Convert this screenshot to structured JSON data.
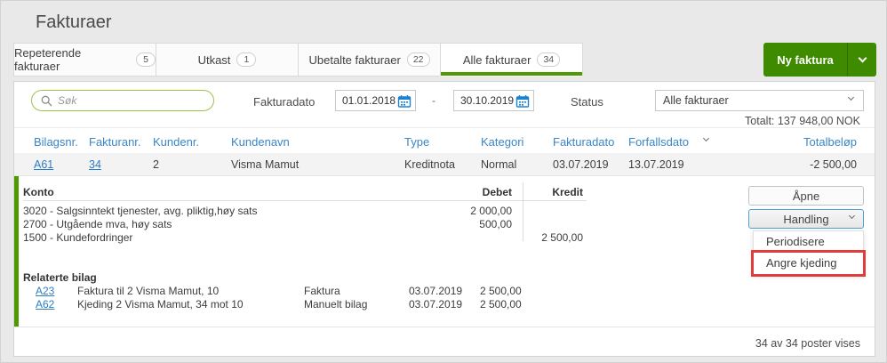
{
  "page": {
    "title": "Fakturaer"
  },
  "tabs": [
    {
      "label": "Repeterende fakturaer",
      "count": "5"
    },
    {
      "label": "Utkast",
      "count": "1"
    },
    {
      "label": "Ubetalte fakturaer",
      "count": "22"
    },
    {
      "label": "Alle fakturaer",
      "count": "34"
    }
  ],
  "new_invoice": {
    "label": "Ny faktura"
  },
  "filters": {
    "search_placeholder": "Søk",
    "invoice_date_label": "Fakturadato",
    "date_from": "01.01.2018",
    "date_separator": "-",
    "date_to": "30.10.2019",
    "status_label": "Status",
    "status_value": "Alle fakturaer",
    "total_label": "Totalt: 137 948,00 NOK"
  },
  "table": {
    "headers": {
      "bilagsnr": "Bilagsnr.",
      "fakturanr": "Fakturanr.",
      "kundenr": "Kundenr.",
      "kundenavn": "Kundenavn",
      "type": "Type",
      "kategori": "Kategori",
      "fakturadato": "Fakturadato",
      "forfallsdato": "Forfallsdato",
      "totalbelop": "Totalbeløp"
    },
    "row": {
      "bilagsnr": "A61",
      "fakturanr": "34",
      "kundenr": "2",
      "kundenavn": "Visma Mamut",
      "type": "Kreditnota",
      "kategori": "Normal",
      "fakturadato": "03.07.2019",
      "forfallsdato": "13.07.2019",
      "totalbelop": "-2 500,00"
    }
  },
  "detail": {
    "konto_header": "Konto",
    "debet_header": "Debet",
    "kredit_header": "Kredit",
    "accounts": [
      {
        "name": "3020 - Salgsinntekt tjenester, avg. pliktig,høy sats",
        "debet": "2 000,00",
        "kredit": ""
      },
      {
        "name": "2700 - Utgående mva, høy sats",
        "debet": "500,00",
        "kredit": ""
      },
      {
        "name": "1500 - Kundefordringer",
        "debet": "",
        "kredit": "2 500,00"
      }
    ],
    "open_button": "Åpne",
    "action_button": "Handling",
    "menu": [
      {
        "label": "Periodisere"
      },
      {
        "label": "Angre kjeding"
      }
    ],
    "related_header": "Relaterte bilag",
    "related": [
      {
        "link": "A23",
        "description": "Faktura til 2 Visma Mamut, 10",
        "type": "Faktura",
        "date": "03.07.2019",
        "amount": "2 500,00"
      },
      {
        "link": "A62",
        "description": "Kjeding 2 Visma Mamut, 34 mot 10",
        "type": "Manuelt bilag",
        "date": "03.07.2019",
        "amount": "2 500,00"
      }
    ]
  },
  "footer": {
    "count_text": "34 av 34 poster vises"
  },
  "colors": {
    "accent_green": "#3f8b00",
    "tab_underline_green": "#4e9a00",
    "link_blue": "#2d7dc4",
    "header_blue": "#3a86c6",
    "calendar_blue": "#1b82d2",
    "search_border_green": "#9ec24c",
    "highlight_red": "#e03c3c"
  },
  "icons": {
    "search": "search-icon",
    "calendar": "calendar-icon",
    "chevron_down": "chevron-down-icon",
    "sort": "sort-chevron-icon"
  }
}
